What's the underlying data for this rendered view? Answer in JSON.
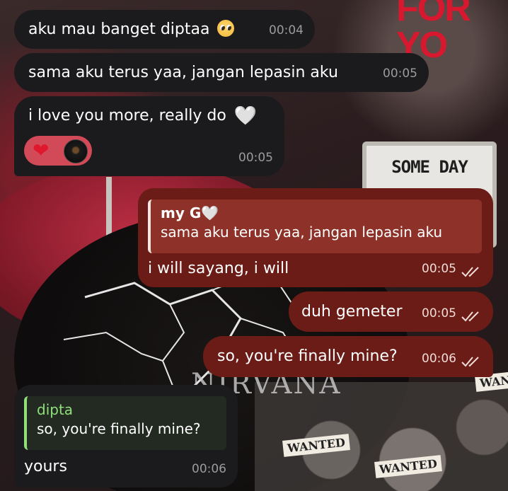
{
  "wallpaper": {
    "title": "FOR YO",
    "sign_text": "SOME DAY",
    "wanted_1": "WANTED",
    "wanted_2": "WANTED",
    "wanted_3": "WAN",
    "band_text": "NIRVANA"
  },
  "colors": {
    "incoming_bubble": "#1b1b1d",
    "outgoing_bubble": "#6b1c16",
    "reply_accent_incoming": "#8fe07b",
    "reaction_pill": "#d24a58"
  },
  "messages": [
    {
      "direction": "incoming",
      "text": "aku mau banget diptaa",
      "emoji": "pleading-face-emoji",
      "time": "00:04"
    },
    {
      "direction": "incoming",
      "text": "sama aku terus yaa, jangan lepasin aku",
      "time": "00:05"
    },
    {
      "direction": "incoming",
      "text": "i love you more, really do",
      "emoji": "white-heart-emoji",
      "time": "00:05",
      "reactions": {
        "heart": "❤",
        "reactor": "avatar"
      }
    },
    {
      "direction": "outgoing",
      "reply_to": {
        "name": "my G",
        "name_emoji": "🤍",
        "text": "sama aku terus yaa, jangan lepasin aku"
      },
      "text": "i will sayang, i will",
      "time": "00:05",
      "status": "read"
    },
    {
      "direction": "outgoing",
      "text": "duh gemeter",
      "time": "00:05",
      "status": "read"
    },
    {
      "direction": "outgoing",
      "text": "so, you're finally mine?",
      "time": "00:06",
      "status": "read"
    },
    {
      "direction": "incoming",
      "reply_to": {
        "name": "dipta",
        "text": "so, you're finally mine?"
      },
      "text": "yours",
      "time": "00:06"
    }
  ]
}
